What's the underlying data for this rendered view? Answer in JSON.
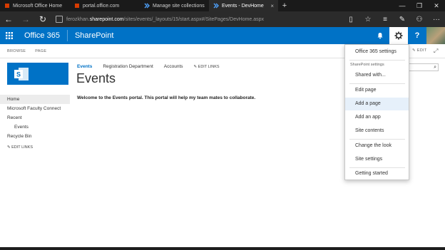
{
  "browser": {
    "tabs": [
      {
        "label": "Microsoft Office Home",
        "icon": "office-icon"
      },
      {
        "label": "portal.office.com",
        "icon": "office-icon"
      },
      {
        "label": "Manage site collections",
        "icon": "sharepoint-icon"
      },
      {
        "label": "Events - DevHome",
        "icon": "sharepoint-icon",
        "active": true
      }
    ],
    "url_user": "ferozkhan.",
    "url_host": "sharepoint.com",
    "url_path": "/sites/events/_layouts/15/start.aspx#/SitePages/DevHome.aspx"
  },
  "suite": {
    "product": "Office 365",
    "app": "SharePoint",
    "help": "?",
    "brand_color": "#0072c6"
  },
  "ribbon": {
    "tab_browse": "BROWSE",
    "tab_page": "PAGE",
    "edit": "EDIT"
  },
  "site": {
    "title": "Events",
    "topnav": [
      "Events",
      "Registration Department",
      "Accounts"
    ],
    "edit_links": "EDIT LINKS",
    "welcome": "Welcome to the Events portal. This portal will help my team mates to collaborate."
  },
  "quicklaunch": {
    "items": [
      "Home",
      "Microsoft Faculty Connect",
      "Recent",
      "Events",
      "Recycle Bin"
    ],
    "edit_links": "EDIT LINKS"
  },
  "settings_menu": {
    "office365_settings": "Office 365 settings",
    "sp_settings_header": "SharePoint settings",
    "shared_with": "Shared with...",
    "edit_page": "Edit page",
    "add_page": "Add a page",
    "add_app": "Add an app",
    "site_contents": "Site contents",
    "change_look": "Change the look",
    "site_settings": "Site settings",
    "getting_started": "Getting started"
  }
}
